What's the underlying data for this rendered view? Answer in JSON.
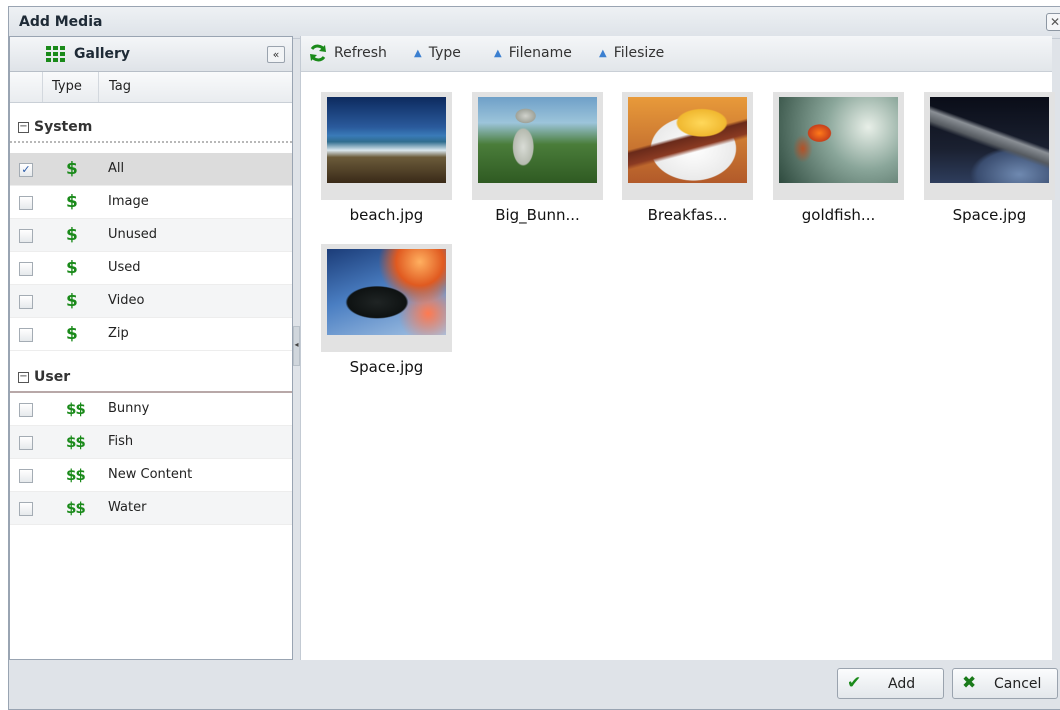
{
  "window": {
    "title": "Add Media",
    "close_glyph": "✕"
  },
  "gallery": {
    "title": "Gallery",
    "collapse_glyph": "«",
    "columns": {
      "type": "Type",
      "tag": "Tag"
    },
    "groups": [
      {
        "label": "System",
        "toggle_glyph": "−",
        "icon": "dollar-icon",
        "rows": [
          {
            "label": "All",
            "checked": true
          },
          {
            "label": "Image",
            "checked": false
          },
          {
            "label": "Unused",
            "checked": false
          },
          {
            "label": "Used",
            "checked": false
          },
          {
            "label": "Video",
            "checked": false
          },
          {
            "label": "Zip",
            "checked": false
          }
        ]
      },
      {
        "label": "User",
        "toggle_glyph": "−",
        "icon": "tag-icon",
        "rows": [
          {
            "label": "Bunny",
            "checked": false
          },
          {
            "label": "Fish",
            "checked": false
          },
          {
            "label": "New Content",
            "checked": false
          },
          {
            "label": "Water",
            "checked": false
          }
        ]
      }
    ]
  },
  "toolbar": {
    "refresh": "Refresh",
    "sort_type": "Type",
    "sort_filename": "Filename",
    "sort_filesize": "Filesize"
  },
  "media": [
    {
      "caption": "beach.jpg",
      "image": "beach"
    },
    {
      "caption": "Big_Bunn...",
      "image": "bunny"
    },
    {
      "caption": "Breakfas...",
      "image": "breakfast"
    },
    {
      "caption": "goldfish...",
      "image": "goldfish"
    },
    {
      "caption": "Space.jpg",
      "image": "space1"
    },
    {
      "caption": "Space.jpg",
      "image": "space2"
    }
  ],
  "footer": {
    "add": "Add",
    "cancel": "Cancel"
  },
  "colors": {
    "accent_green": "#1a8a1a",
    "cancel_green": "#1a7a1a",
    "sort_arrow": "#3b7fd0"
  }
}
